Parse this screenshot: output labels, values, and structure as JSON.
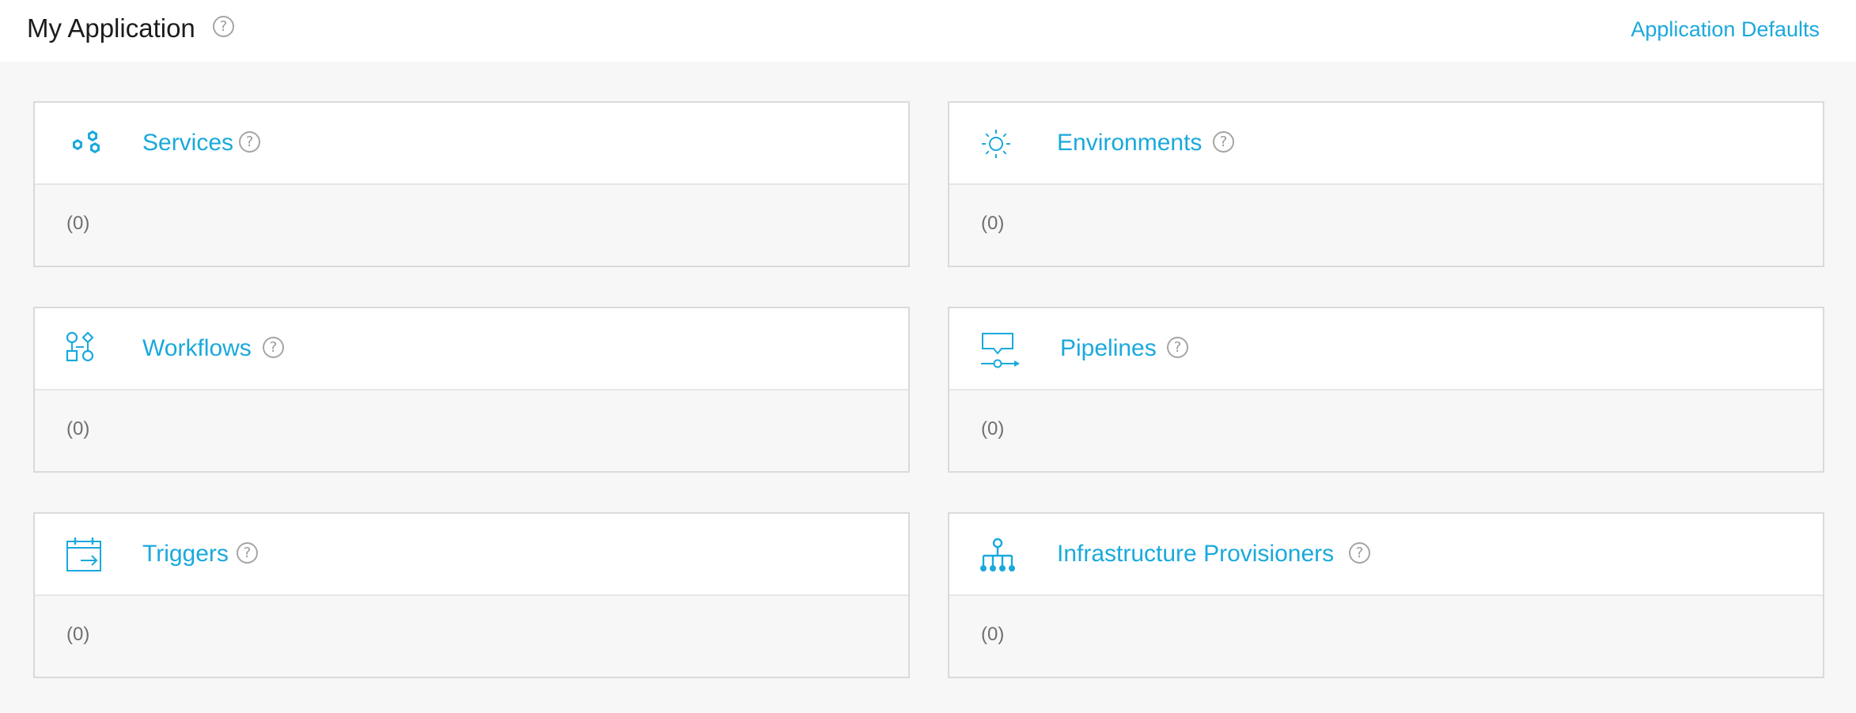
{
  "header": {
    "title": "My Application",
    "help_glyph": "?",
    "defaults_link": "Application Defaults"
  },
  "cards": [
    {
      "title": "Services",
      "count": "(0)",
      "icon": "services-icon"
    },
    {
      "title": "Environments",
      "count": "(0)",
      "icon": "environments-icon"
    },
    {
      "title": "Workflows",
      "count": "(0)",
      "icon": "workflows-icon"
    },
    {
      "title": "Pipelines",
      "count": "(0)",
      "icon": "pipelines-icon"
    },
    {
      "title": "Triggers",
      "count": "(0)",
      "icon": "triggers-icon"
    },
    {
      "title": "Infrastructure Provisioners",
      "count": "(0)",
      "icon": "infrastructure-provisioners-icon"
    }
  ],
  "colors": {
    "accent": "#1aa9dc",
    "page_background": "#f7f7f7",
    "card_header_background": "#ffffff",
    "border": "#dadada",
    "count_text": "#6f6f6f"
  }
}
